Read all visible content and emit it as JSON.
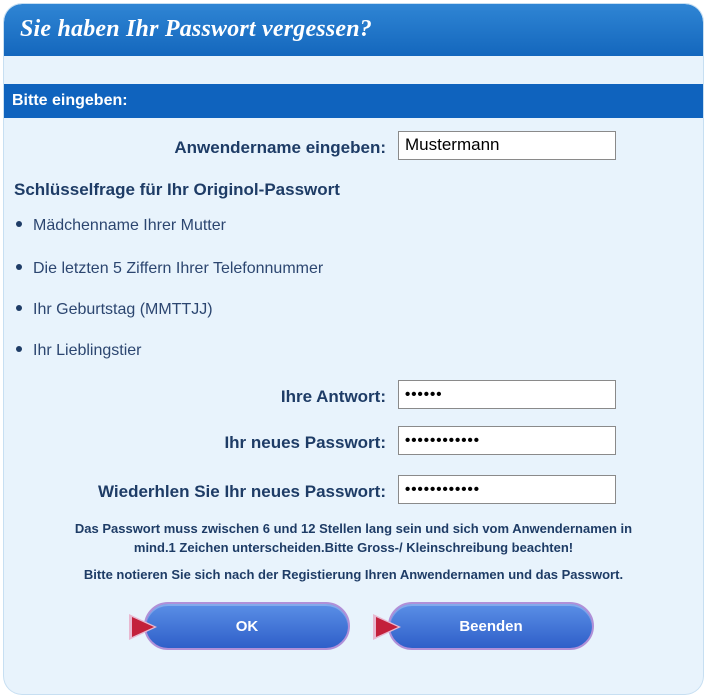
{
  "dialog": {
    "title": "Sie haben Ihr Passwort vergessen?",
    "subheader": "Bitte eingeben:"
  },
  "username": {
    "label": "Anwendername eingeben:",
    "value": "Mustermann"
  },
  "security": {
    "title": "Schlüsselfrage für Ihr Originol-Passwort",
    "questions": [
      "Mädchenname Ihrer Mutter",
      "Die letzten 5 Ziffern Ihrer Telefonnummer",
      "Ihr Geburtstag (MMTTJJ)",
      "Ihr Lieblingstier"
    ]
  },
  "answer": {
    "label": "Ihre Antwort:",
    "masked": "••••••"
  },
  "new_password": {
    "label": "Ihr neues Passwort:",
    "masked": "••••••••••••"
  },
  "repeat_password": {
    "label": "Wiederhlen Sie Ihr neues Passwort:",
    "masked": "••••••••••••"
  },
  "notes": {
    "line1": "Das Passwort muss zwischen 6 und 12 Stellen lang sein und sich vom Anwendernamen in",
    "line2": "mind.1 Zeichen unterscheiden.Bitte Gross-/ Kleinschreibung beachten!",
    "line3": "Bitte notieren Sie sich nach der Registierung Ihren Anwendernamen und das Passwort."
  },
  "buttons": {
    "ok": "OK",
    "cancel": "Beenden"
  },
  "colors": {
    "titlebar": "#1467bd",
    "subheader": "#0f63be",
    "background": "#e8f3fc",
    "button": "#2f5fc9",
    "arrow": "#c3203b"
  }
}
